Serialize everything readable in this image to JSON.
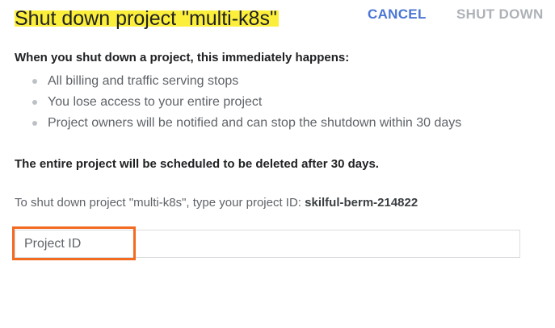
{
  "dialog": {
    "title_prefix": "Shut down project ",
    "title_project": "\"multi-k8s\"",
    "intro": "When you shut down a project, this immediately happens:",
    "bullets": [
      "All billing and traffic serving stops",
      "You lose access to your entire project",
      "Project owners will be notified and can stop the shutdown within 30 days"
    ],
    "warning": "The entire project will be scheduled to be deleted after 30 days.",
    "instruction_text": "To shut down project \"multi-k8s\", type your project ID: ",
    "project_id": "skilful-berm-214822",
    "input": {
      "placeholder": "Project ID",
      "value": ""
    },
    "cancel_label": "CANCEL",
    "shutdown_label": "SHUT DOWN"
  },
  "colors": {
    "highlight_yellow": "#fcef3c",
    "annotation_orange": "#f26b21",
    "cancel_blue": "#4a76d6",
    "disabled_gray": "#aeb2b7"
  }
}
